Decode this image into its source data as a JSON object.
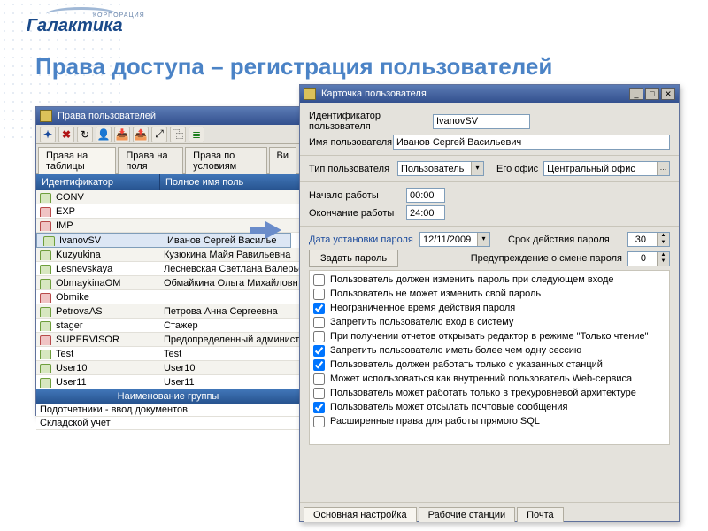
{
  "logo": {
    "brand": "Галактика",
    "corp": "КОРПОРАЦИЯ"
  },
  "title": "Права доступа – регистрация пользователей",
  "win1": {
    "title": "Права пользователей",
    "tabs": [
      "Права на таблицы",
      "Права на поля",
      "Права по условиям",
      "Ви"
    ],
    "columns": {
      "id": "Идентификатор",
      "name": "Полное имя поль"
    },
    "rows": [
      {
        "id": "CONV",
        "name": "",
        "red": false
      },
      {
        "id": "EXP",
        "name": "",
        "red": true
      },
      {
        "id": "IMP",
        "name": "",
        "red": true
      },
      {
        "id": "IvanovSV",
        "name": "Иванов Сергей Василье",
        "red": false,
        "selected": true
      },
      {
        "id": "Kuzyukina",
        "name": "Кузюкина Майя Равильевна",
        "red": false
      },
      {
        "id": "Lesnevskaya",
        "name": "Лесневская Светлана Валерье",
        "red": false
      },
      {
        "id": "ObmaykinaOM",
        "name": "Обмайкина Ольга Михайловн",
        "red": false
      },
      {
        "id": "Obmike",
        "name": "",
        "red": true
      },
      {
        "id": "PetrovaAS",
        "name": "Петрова Анна Сергеевна",
        "red": false
      },
      {
        "id": "stager",
        "name": "Стажер",
        "red": false
      },
      {
        "id": "SUPERVISOR",
        "name": "Предопределенный админист",
        "red": true
      },
      {
        "id": "Test",
        "name": "Test",
        "red": false
      },
      {
        "id": "User10",
        "name": "User10",
        "red": false
      },
      {
        "id": "User11",
        "name": "User11",
        "red": false
      }
    ],
    "group_header": "Наименование группы",
    "groups": [
      "Подотчетники - ввод документов",
      "Складской учет"
    ]
  },
  "win2": {
    "title": "Карточка пользователя",
    "labels": {
      "user_id": "Идентификатор пользователя",
      "user_name": "Имя пользователя",
      "user_type": "Тип пользователя",
      "office": "Его офис",
      "work_start": "Начало работы",
      "work_end": "Окончание работы",
      "pass_date": "Дата установки пароля",
      "pass_expire": "Срок действия пароля",
      "set_pass": "Задать пароль",
      "pass_warn": "Предупреждение о смене пароля"
    },
    "values": {
      "user_id": "IvanovSV",
      "user_name": "Иванов Сергей Васильевич",
      "user_type": "Пользователь",
      "office": "Центральный офис",
      "work_start": "00:00",
      "work_end": "24:00",
      "pass_date": "12/11/2009",
      "pass_expire": "30",
      "pass_warn": "0"
    },
    "checkboxes": [
      {
        "checked": false,
        "label": "Пользователь должен изменить пароль при следующем входе"
      },
      {
        "checked": false,
        "label": "Пользователь не может изменить свой пароль"
      },
      {
        "checked": true,
        "label": "Неограниченное время действия пароля"
      },
      {
        "checked": false,
        "label": "Запретить пользователю вход в систему"
      },
      {
        "checked": false,
        "label": "При получении отчетов открывать редактор в режиме \"Только чтение\""
      },
      {
        "checked": true,
        "label": "Запретить пользователю иметь более чем одну сессию"
      },
      {
        "checked": true,
        "label": "Пользователь должен работать только с указанных станций"
      },
      {
        "checked": false,
        "label": "Может использоваться как внутренний пользователь Web-сервиса"
      },
      {
        "checked": false,
        "label": "Пользователь может работать только в трехуровневой архитектуре"
      },
      {
        "checked": true,
        "label": "Пользователь может отсылать почтовые сообщения"
      },
      {
        "checked": false,
        "label": "Расширенные права для работы прямого SQL"
      }
    ],
    "bottom_tabs": [
      "Основная настройка",
      "Рабочие станции",
      "Почта"
    ]
  }
}
